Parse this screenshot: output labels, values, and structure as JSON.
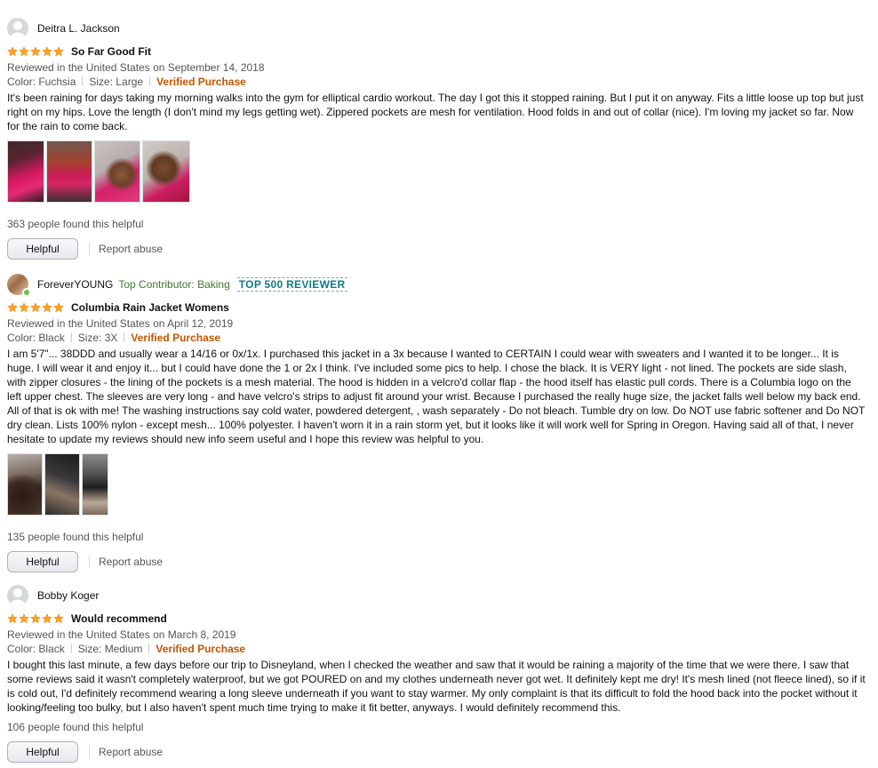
{
  "reviews": [
    {
      "reviewer": "Deitra L. Jackson",
      "title": "So Far Good Fit",
      "rating": 5,
      "date": "Reviewed in the United States on September 14, 2018",
      "color": "Color: Fuchsia",
      "size": "Size: Large",
      "verified": "Verified Purchase",
      "body": "It's been raining for days taking my morning walks into the gym for elliptical cardio workout. The day I got this it stopped raining. But I put it on anyway. Fits a little loose up top but just right on my hips. Love the length (I don't mind my legs getting wet). Zippered pockets are mesh for ventilation. Hood folds in and out of collar (nice). I'm loving my jacket so far. Now for the rain to come back.",
      "helpful_count": "363 people found this helpful",
      "helpful_label": "Helpful",
      "report_label": "Report abuse"
    },
    {
      "reviewer": "ForeverYOUNG",
      "contributor": "Top Contributor: Baking",
      "rank": "TOP 500 REVIEWER",
      "title": "Columbia Rain Jacket Womens",
      "rating": 5,
      "date": "Reviewed in the United States on April 12, 2019",
      "color": "Color: Black",
      "size": "Size: 3X",
      "verified": "Verified Purchase",
      "body": "I am 5'7\"... 38DDD and usually wear a 14/16 or 0x/1x. I purchased this jacket in a 3x because I wanted to CERTAIN I could wear with sweaters and I wanted it to be longer... It is huge. I will wear it and enjoy it... but I could have done the 1 or 2x I think. I've included some pics to help. I chose the black. It is VERY light - not lined. The pockets are side slash, with zipper closures - the lining of the pockets is a mesh material. The hood is hidden in a velcro'd collar flap - the hood itself has elastic pull cords. There is a Columbia logo on the left upper chest. The sleeves are very long - and have velcro's strips to adjust fit around your wrist. Because I purchased the really huge size, the jacket falls well below my back end. All of that is ok with me! The washing instructions say cold water, powdered detergent, , wash separately - Do not bleach. Tumble dry on low. Do NOT use fabric softener and Do NOT dry clean. Lists 100% nylon - except mesh... 100% polyester. I haven't worn it in a rain storm yet, but it looks like it will work well for Spring in Oregon. Having said all of that, I never hesitate to update my reviews should new info seem useful and I hope this review was helpful to you.",
      "helpful_count": "135 people found this helpful",
      "helpful_label": "Helpful",
      "report_label": "Report abuse"
    },
    {
      "reviewer": "Bobby Koger",
      "title": "Would recommend",
      "rating": 5,
      "date": "Reviewed in the United States on March 8, 2019",
      "color": "Color: Black",
      "size": "Size: Medium",
      "verified": "Verified Purchase",
      "body": "I bought this last minute, a few days before our trip to Disneyland, when I checked the weather and saw that it would be raining a majority of the time that we were there. I saw that some reviews said it wasn't completely waterproof, but we got POURED on and my clothes underneath never got wet. It definitely kept me dry! It's mesh lined (not fleece lined), so if it is cold out, I'd definitely recommend wearing a long sleeve underneath if you want to stay warmer. My only complaint is that its difficult to fold the hood back into the pocket without it looking/feeling too bulky, but I also haven't spent much time trying to make it fit better, anyways. I would definitely recommend this.",
      "helpful_count": "106 people found this helpful",
      "helpful_label": "Helpful",
      "report_label": "Report abuse"
    }
  ],
  "colors": {
    "star": "#ffa41c",
    "verified": "#c45500",
    "rank_badge": "#0f7a87",
    "contributor": "#3f7a2e"
  },
  "icons": {
    "avatar": "default-person-icon",
    "star": "star-icon"
  }
}
